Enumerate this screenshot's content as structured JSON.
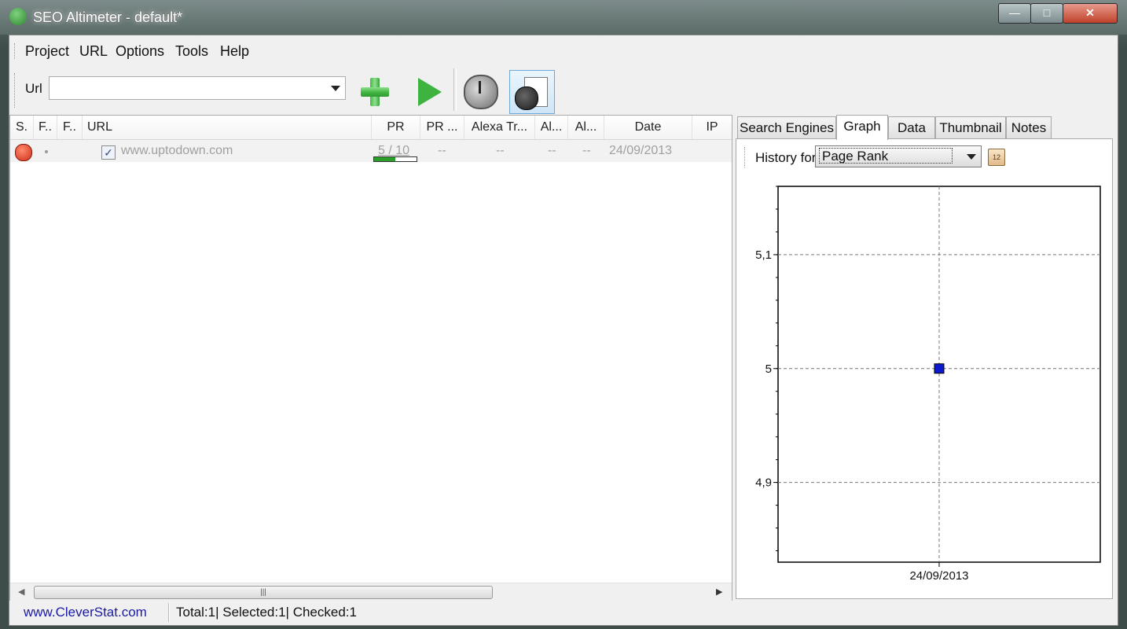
{
  "window": {
    "title": "SEO Altimeter - default*"
  },
  "menu": [
    "Project",
    "URL",
    "Options",
    "Tools",
    "Help"
  ],
  "toolbar": {
    "url_label": "Url",
    "url_value": ""
  },
  "table": {
    "columns": [
      "S.",
      "F..",
      "F..",
      "URL",
      "PR",
      "PR ...",
      "Alexa Tr...",
      "Al...",
      "Al...",
      "Date",
      "IP"
    ],
    "rows": [
      {
        "status": "error",
        "checked": true,
        "url": "www.uptodown.com",
        "pr": "5 / 10",
        "pr_fraction": 0.5,
        "pr2": "--",
        "alexa": "--",
        "al1": "--",
        "al2": "--",
        "date": "24/09/2013",
        "ip": ""
      }
    ]
  },
  "tabs": [
    {
      "label": "Search Engines",
      "active": false
    },
    {
      "label": "Graph",
      "active": true
    },
    {
      "label": "Data",
      "active": false
    },
    {
      "label": "Thumbnail",
      "active": false
    },
    {
      "label": "Notes",
      "active": false
    }
  ],
  "graph": {
    "history_label": "History for",
    "history_value": "Page Rank"
  },
  "chart_data": {
    "type": "scatter",
    "x": [
      "24/09/2013"
    ],
    "y": [
      5
    ],
    "ylim": [
      4.83,
      5.16
    ],
    "yticks": [
      4.9,
      5,
      5.1
    ],
    "ytick_labels": [
      "4,9",
      "5",
      "5,1"
    ],
    "xtick_labels": [
      "24/09/2013"
    ],
    "grid": true,
    "marker_color": "#0a1acc"
  },
  "status": {
    "link": "www.CleverStat.com",
    "text": "Total:1|  Selected:1|  Checked:1"
  }
}
